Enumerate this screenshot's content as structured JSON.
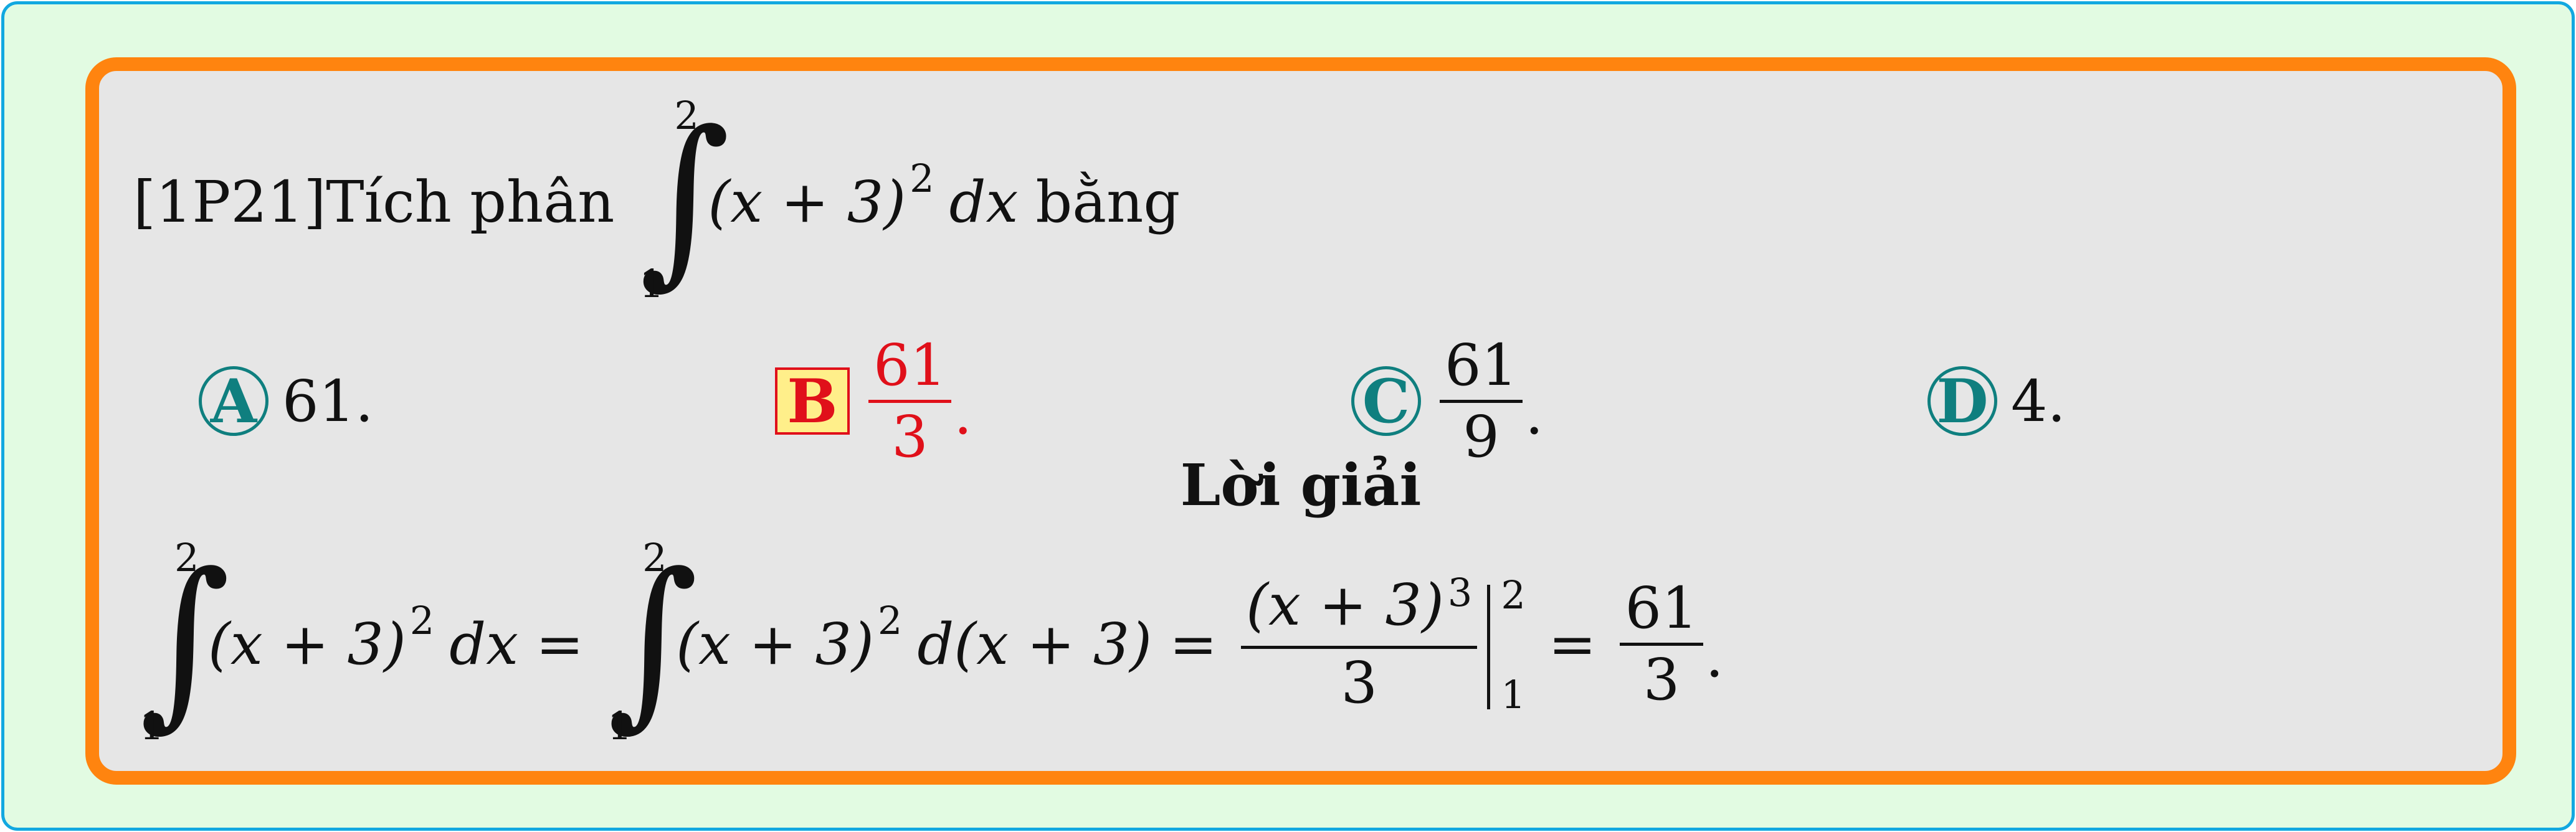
{
  "question": {
    "code": "[1P21]",
    "text_before": "Tích phân",
    "integral_upper": "2",
    "integral_lower": "1",
    "integrand": "(x + 3)",
    "exponent": "2",
    "differential": "dx",
    "text_after": "bằng"
  },
  "options": [
    {
      "letter": "A",
      "value": "61.",
      "selected": false
    },
    {
      "letter": "B",
      "numerator": "61",
      "denominator": "3",
      "suffix": ".",
      "selected": true
    },
    {
      "letter": "C",
      "numerator": "61",
      "denominator": "9",
      "suffix": ".",
      "selected": false
    },
    {
      "letter": "D",
      "value": "4.",
      "selected": false
    }
  ],
  "solution": {
    "title": "Lời giải",
    "int1": {
      "upper": "2",
      "lower": "1",
      "integrand": "(x + 3)",
      "exponent": "2",
      "differential": "dx"
    },
    "equals": "=",
    "int2": {
      "upper": "2",
      "lower": "1",
      "integrand": "(x + 3)",
      "exponent": "2",
      "differential": "d(x + 3)"
    },
    "antideriv": {
      "numerator": "(x + 3)",
      "exponent": "3",
      "denominator": "3",
      "upper": "2",
      "lower": "1"
    },
    "result": {
      "numerator": "61",
      "denominator": "3",
      "suffix": "."
    }
  },
  "colors": {
    "frame_outer": "#12a8e0",
    "background_outer": "#e2fbe2",
    "frame_inner": "#ff840f",
    "background_inner": "#e6e6e6",
    "correct_answer": "#e0101a",
    "option_circle": "#0f7f7f"
  }
}
